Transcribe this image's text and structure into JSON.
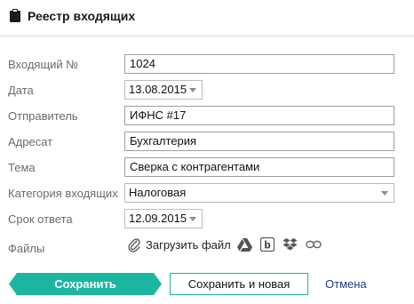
{
  "header": {
    "title": "Реестр входящих",
    "icon": "clipboard-icon"
  },
  "form": {
    "incoming_no": {
      "label": "Входящий №",
      "value": "1024"
    },
    "date": {
      "label": "Дата",
      "value": "13.08.2015"
    },
    "sender": {
      "label": "Отправитель",
      "value": "ИФНС #17"
    },
    "addressee": {
      "label": "Адресат",
      "value": "Бухгалтерия"
    },
    "subject": {
      "label": "Тема",
      "value": "Сверка с контрагентами"
    },
    "category": {
      "label": "Категория входящих",
      "value": "Налоговая"
    },
    "deadline": {
      "label": "Срок ответа",
      "value": "12.09.2015"
    },
    "files": {
      "label": "Файлы",
      "upload_label": "Загрузить файл",
      "sources": [
        "paperclip-icon",
        "google-drive-icon",
        "box-icon",
        "dropbox-icon",
        "link-icon"
      ]
    }
  },
  "actions": {
    "save_label": "Сохранить",
    "save_new_label": "Сохранить и новая",
    "cancel_label": "Отмена"
  },
  "colors": {
    "accent": "#1cb5a0",
    "link": "#1a3d8f",
    "label": "#6b6b6b"
  }
}
